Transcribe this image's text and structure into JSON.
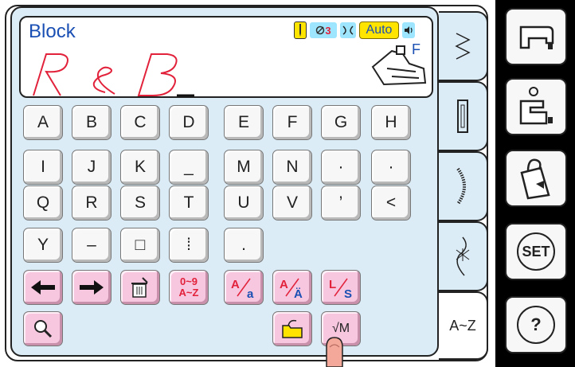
{
  "display": {
    "mode_title": "Block",
    "stitch_number": "3",
    "auto_label": "Auto",
    "preview_text": "R & B_",
    "presser_foot": "F"
  },
  "keys": {
    "row1": [
      "A",
      "B",
      "C",
      "D",
      "E",
      "F",
      "G",
      "H"
    ],
    "row2": [
      "I",
      "J",
      "K",
      "_",
      "M",
      "N",
      "·",
      "·"
    ],
    "row3": [
      "Q",
      "R",
      "S",
      "T",
      "U",
      "V",
      "’",
      "<"
    ],
    "row4": [
      "Y",
      "–",
      "□",
      "⁞",
      "."
    ],
    "function_row": [
      {
        "name": "left-arrow-button",
        "icon": "arrow-left-icon"
      },
      {
        "name": "right-arrow-button",
        "icon": "arrow-right-icon"
      },
      {
        "name": "delete-button",
        "icon": "trash-icon"
      },
      {
        "name": "number-set-button",
        "label_top": "0~9",
        "label_bottom": "A~Z"
      },
      {
        "name": "case-button",
        "label": "A/a"
      },
      {
        "name": "accent-button",
        "label": "A/Ä"
      },
      {
        "name": "size-button",
        "label": "L/S"
      }
    ],
    "bottom_row": {
      "zoom_icon": "magnifier-icon",
      "memory_icon": "folder-icon",
      "check_memory_label": "√M"
    }
  },
  "tabs": [
    {
      "name": "tab-utility",
      "icon": "zigzag-icon"
    },
    {
      "name": "tab-buttonhole",
      "icon": "buttonhole-icon"
    },
    {
      "name": "tab-satin",
      "icon": "satin-icon"
    },
    {
      "name": "tab-quilt",
      "icon": "quilt-icon"
    },
    {
      "name": "tab-alphabet",
      "label": "A~Z",
      "active": true
    }
  ],
  "side_buttons": [
    {
      "name": "sewing-machine-button",
      "icon": "sewing-machine-icon"
    },
    {
      "name": "embroidery-button",
      "icon": "embroidery-machine-icon"
    },
    {
      "name": "bag-button",
      "icon": "bag-icon"
    },
    {
      "name": "set-button",
      "label": "SET"
    },
    {
      "name": "help-button",
      "label": "?"
    }
  ],
  "colors": {
    "panel": "#dcecf6",
    "title": "#1a4fb3",
    "preview_stroke": "#e2223b",
    "pink_key": "#f7c6df",
    "auto_badge": "#ffe400",
    "status_badge": "#9ee6ff"
  }
}
